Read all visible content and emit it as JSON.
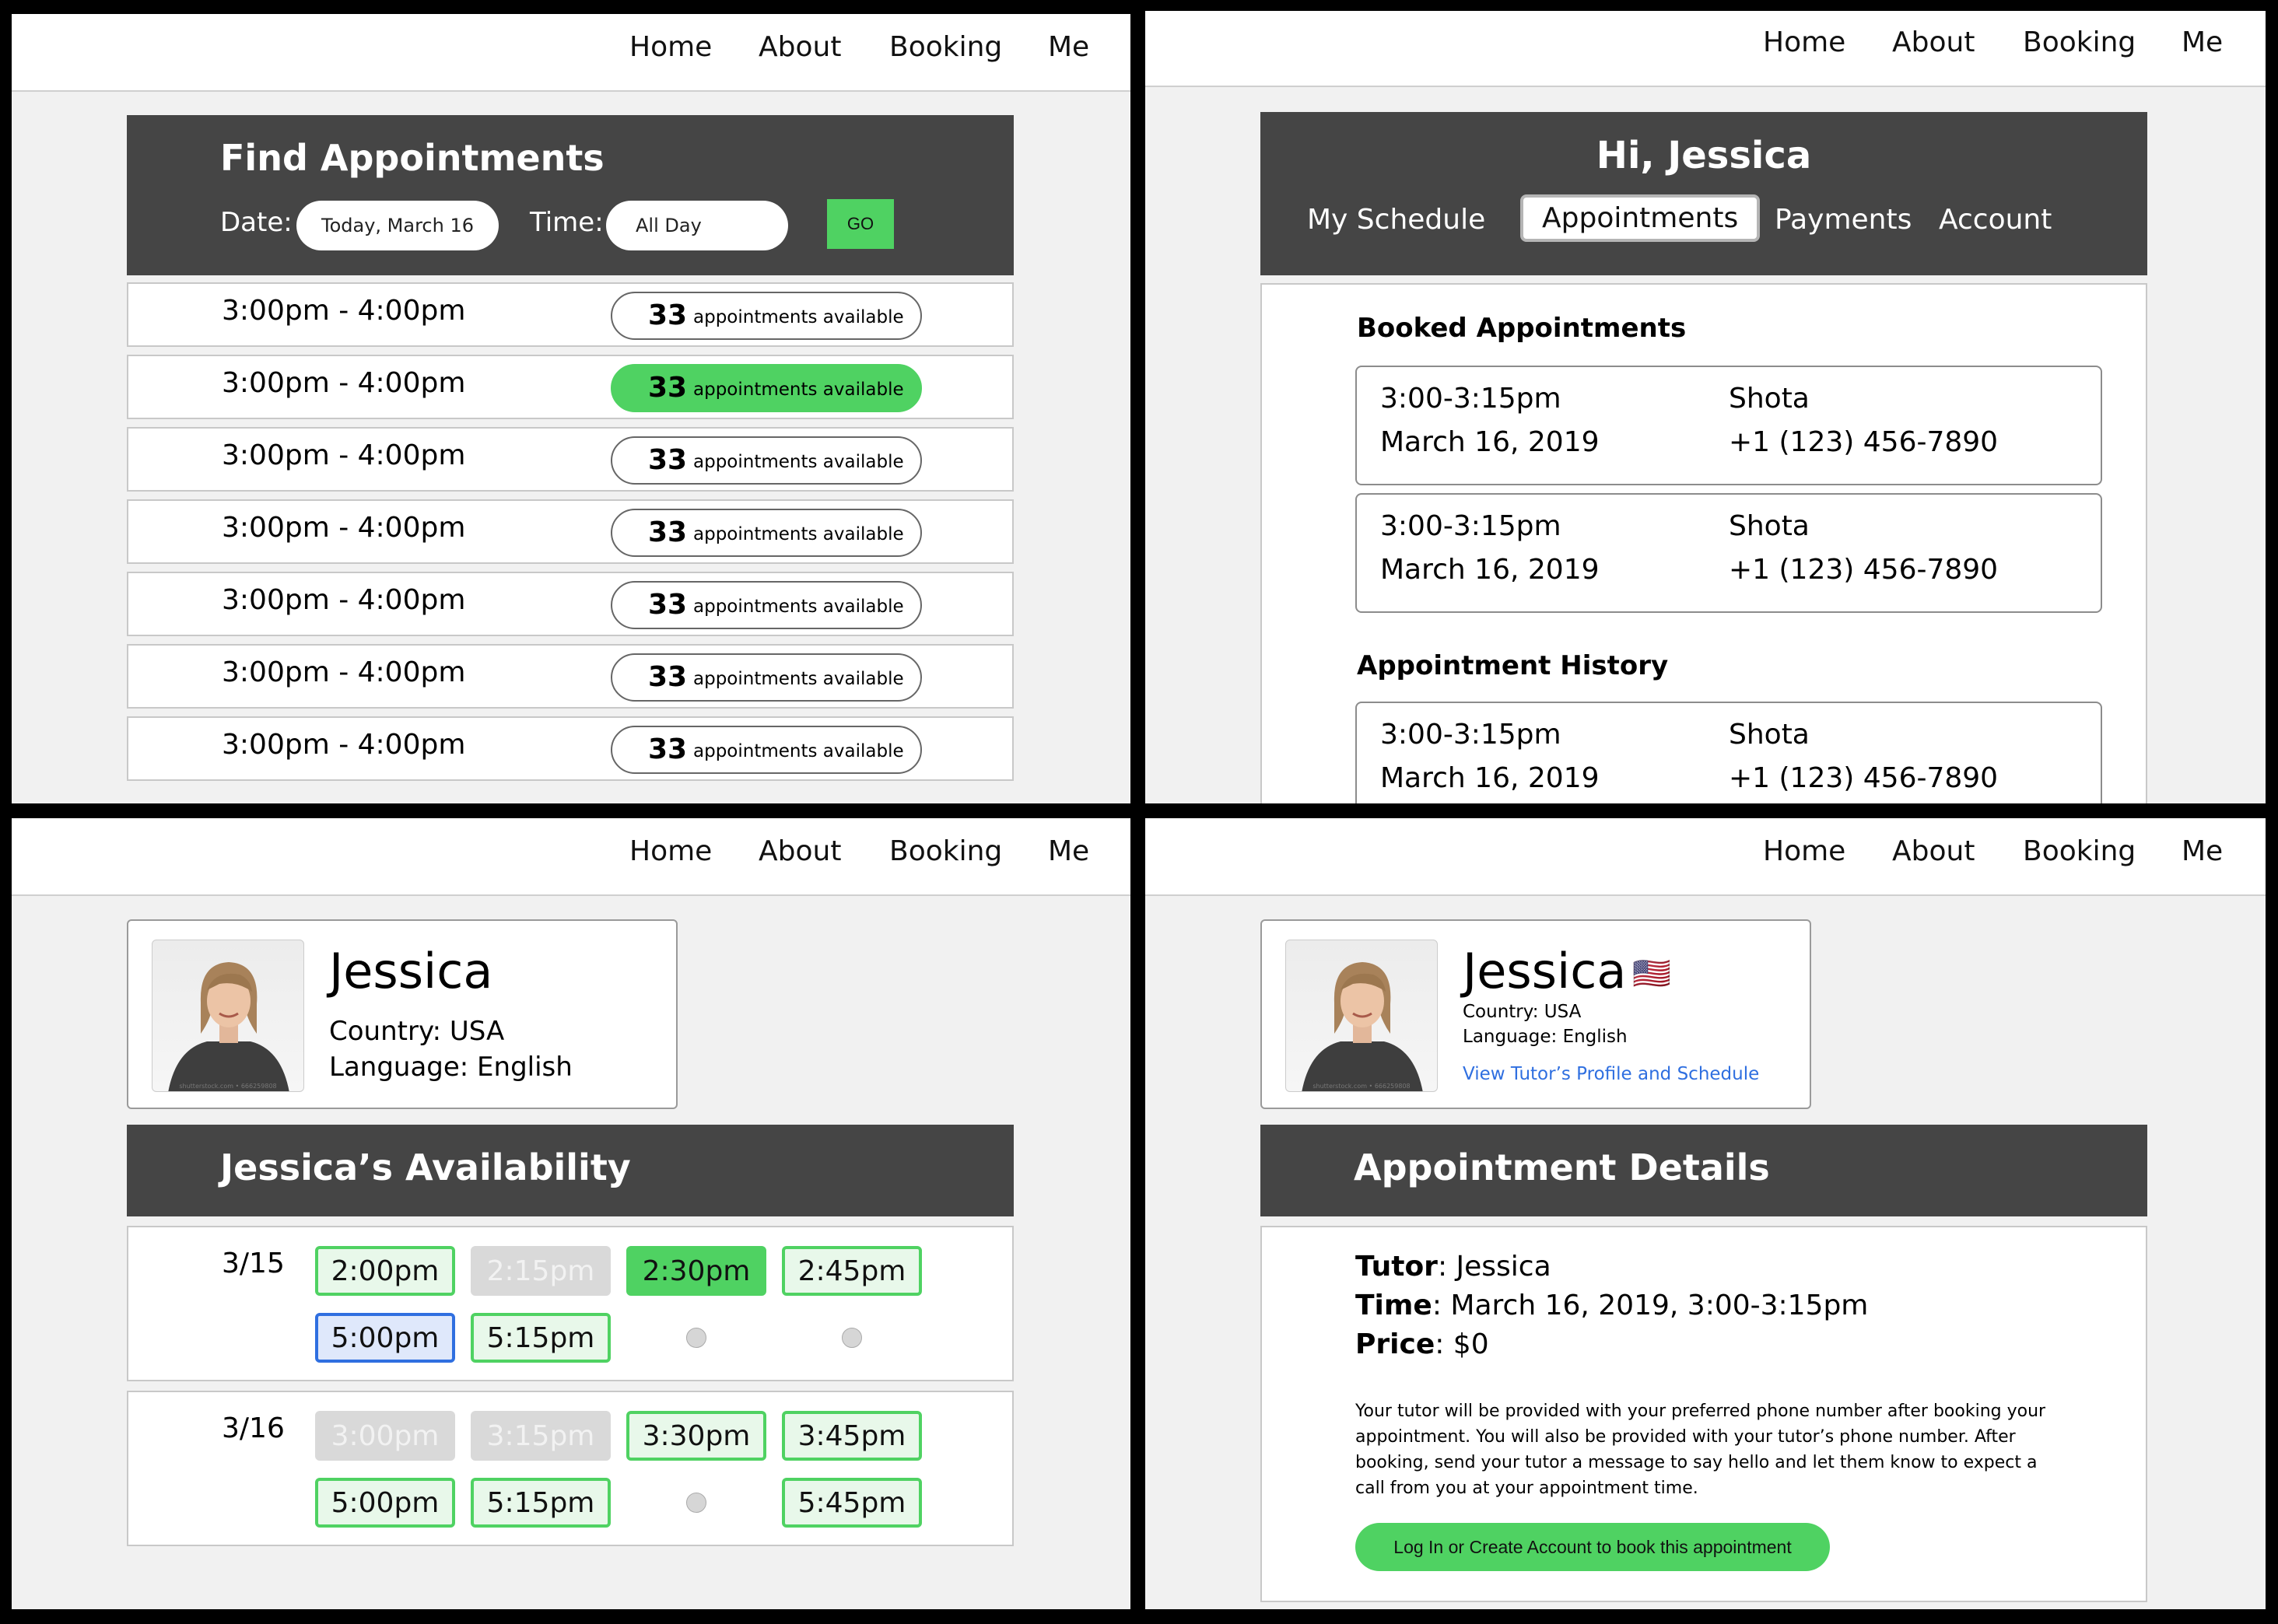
{
  "nav": {
    "home": "Home",
    "about": "About",
    "booking": "Booking",
    "me": "Me"
  },
  "find": {
    "title": "Find Appointments",
    "date_label": "Date:",
    "date_value": "Today, March 16",
    "time_label": "Time:",
    "time_value": "All Day",
    "go": "GO",
    "slots": [
      {
        "time": "3:00pm - 4:00pm",
        "count": "33",
        "label": "appointments available"
      },
      {
        "time": "3:00pm - 4:00pm",
        "count": "33",
        "label": "appointments available"
      },
      {
        "time": "3:00pm - 4:00pm",
        "count": "33",
        "label": "appointments available"
      },
      {
        "time": "3:00pm - 4:00pm",
        "count": "33",
        "label": "appointments available"
      },
      {
        "time": "3:00pm - 4:00pm",
        "count": "33",
        "label": "appointments available"
      },
      {
        "time": "3:00pm - 4:00pm",
        "count": "33",
        "label": "appointments available"
      },
      {
        "time": "3:00pm - 4:00pm",
        "count": "33",
        "label": "appointments available"
      }
    ]
  },
  "account": {
    "greeting": "Hi, Jessica",
    "tabs": [
      "My Schedule",
      "Appointments",
      "Payments",
      "Account"
    ],
    "booked_title": "Booked Appointments",
    "history_title": "Appointment History",
    "booked": [
      {
        "time": "3:00-3:15pm",
        "date": "March 16, 2019",
        "name": "Shota",
        "phone": "+1 (123) 456-7890"
      },
      {
        "time": "3:00-3:15pm",
        "date": "March 16, 2019",
        "name": "Shota",
        "phone": "+1 (123) 456-7890"
      }
    ],
    "history": [
      {
        "time": "3:00-3:15pm",
        "date": "March 16, 2019",
        "name": "Shota",
        "phone": "+1 (123) 456-7890"
      }
    ]
  },
  "tutor": {
    "name": "Jessica",
    "country": "Country: USA",
    "language": "Language: English",
    "photo_caption": "shutterstock.com • 666259808",
    "flag": "🇺🇸",
    "profile_link": "View Tutor’s Profile and Schedule"
  },
  "availability": {
    "title": "Jessica’s Availability",
    "days": [
      {
        "date": "3/15",
        "slots": [
          "2:00pm",
          "2:15pm",
          "2:30pm",
          "2:45pm",
          "5:00pm",
          "5:15pm"
        ]
      },
      {
        "date": "3/16",
        "slots": [
          "3:00pm",
          "3:15pm",
          "3:30pm",
          "3:45pm",
          "5:00pm",
          "5:15pm",
          "5:45pm"
        ]
      }
    ]
  },
  "details": {
    "title": "Appointment Details",
    "tutor_label": "Tutor",
    "tutor_value": ": Jessica",
    "time_label": "Time",
    "time_value": ": March 16, 2019, 3:00-3:15pm",
    "price_label": "Price",
    "price_value": ": $0",
    "note": "Your tutor will be provided with your preferred phone number after booking your appointment. You will also be provided with your tutor’s phone number. After booking, send your tutor a message to say hello and let them know to expect a call from you at your appointment time.",
    "button": "Log In or Create Account to book this appointment"
  },
  "colors": {
    "accent_green": "#4fd262",
    "dark_bar": "#454545",
    "selected_blue": "#2f6fe0",
    "link_blue": "#2f6fe0"
  }
}
